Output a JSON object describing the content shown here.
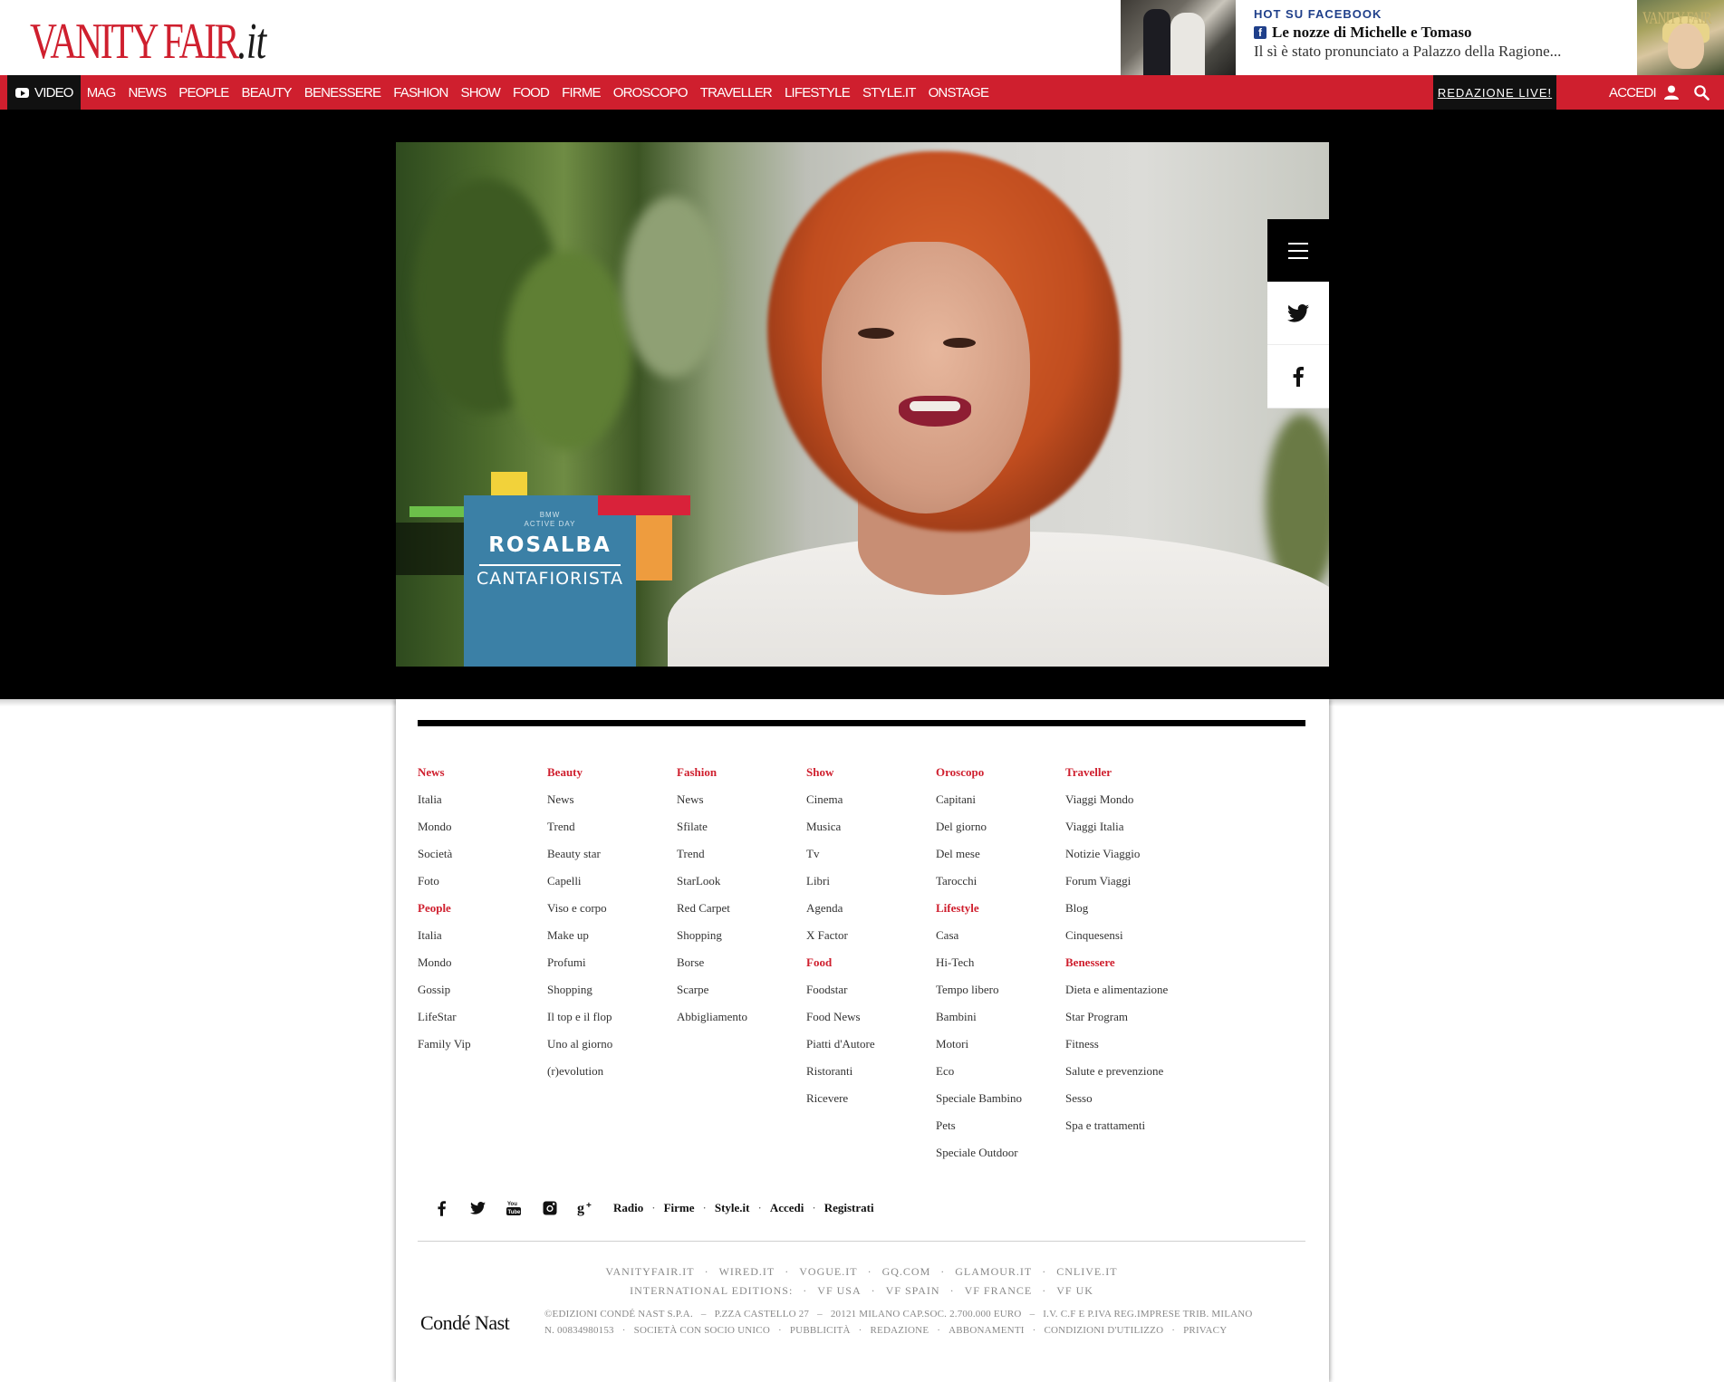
{
  "header": {
    "logo_main": "VANITY FAIR",
    "logo_suffix": ".it",
    "hot": {
      "label": "HOT SU FACEBOOK",
      "title": "Le nozze di Michelle e Tomaso",
      "subtitle": "Il sì è stato pronunciato a Palazzo della Ragione..."
    },
    "magazine_logo": "VANITY FAIR"
  },
  "nav": {
    "video_label": "VIDEO",
    "items": [
      "MAG",
      "NEWS",
      "PEOPLE",
      "BEAUTY",
      "BENESSERE",
      "FASHION",
      "SHOW",
      "FOOD",
      "FIRME",
      "OROSCOPO",
      "TRAVELLER",
      "LIFESTYLE",
      "STYLE.IT",
      "ONSTAGE"
    ],
    "redazione": "REDAZIONE LIVE!",
    "accedi": "ACCEDI"
  },
  "video": {
    "lower_third_small_1": "BMW",
    "lower_third_small_2": "ACTIVE DAY",
    "name": "ROSALBA",
    "surname": "CANTAFIORISTA"
  },
  "share": {
    "menu_icon": "hamburger-icon",
    "buttons": [
      "twitter-icon",
      "facebook-icon"
    ]
  },
  "footer": {
    "columns": [
      [
        {
          "text": "News",
          "head": true
        },
        {
          "text": "Italia"
        },
        {
          "text": "Mondo"
        },
        {
          "text": "Società"
        },
        {
          "text": "Foto"
        },
        {
          "text": "People",
          "head": true
        },
        {
          "text": "Italia"
        },
        {
          "text": "Mondo"
        },
        {
          "text": "Gossip"
        },
        {
          "text": "LifeStar"
        },
        {
          "text": "Family Vip"
        }
      ],
      [
        {
          "text": "Beauty",
          "head": true
        },
        {
          "text": "News"
        },
        {
          "text": "Trend"
        },
        {
          "text": "Beauty star"
        },
        {
          "text": "Capelli"
        },
        {
          "text": "Viso e corpo"
        },
        {
          "text": "Make up"
        },
        {
          "text": "Profumi"
        },
        {
          "text": "Shopping"
        },
        {
          "text": "Il top e il flop"
        },
        {
          "text": "Uno al giorno"
        },
        {
          "text": "(r)evolution"
        }
      ],
      [
        {
          "text": "Fashion",
          "head": true
        },
        {
          "text": "News"
        },
        {
          "text": "Sfilate"
        },
        {
          "text": "Trend"
        },
        {
          "text": "StarLook"
        },
        {
          "text": "Red Carpet"
        },
        {
          "text": "Shopping"
        },
        {
          "text": "Borse"
        },
        {
          "text": "Scarpe"
        },
        {
          "text": "Abbigliamento"
        }
      ],
      [
        {
          "text": "Show",
          "head": true
        },
        {
          "text": "Cinema"
        },
        {
          "text": "Musica"
        },
        {
          "text": "Tv"
        },
        {
          "text": "Libri"
        },
        {
          "text": "Agenda"
        },
        {
          "text": "X Factor"
        },
        {
          "text": "Food",
          "head": true
        },
        {
          "text": "Foodstar"
        },
        {
          "text": "Food News"
        },
        {
          "text": "Piatti d'Autore"
        },
        {
          "text": "Ristoranti"
        },
        {
          "text": "Ricevere"
        }
      ],
      [
        {
          "text": "Oroscopo",
          "head": true
        },
        {
          "text": "Capitani"
        },
        {
          "text": "Del giorno"
        },
        {
          "text": "Del mese"
        },
        {
          "text": "Tarocchi"
        },
        {
          "text": "Lifestyle",
          "head": true
        },
        {
          "text": "Casa"
        },
        {
          "text": "Hi-Tech"
        },
        {
          "text": "Tempo libero"
        },
        {
          "text": "Bambini"
        },
        {
          "text": "Motori"
        },
        {
          "text": "Eco"
        },
        {
          "text": "Speciale Bambino"
        },
        {
          "text": "Pets"
        },
        {
          "text": "Speciale Outdoor"
        }
      ],
      [
        {
          "text": "Traveller",
          "head": true
        },
        {
          "text": "Viaggi Mondo"
        },
        {
          "text": "Viaggi Italia"
        },
        {
          "text": "Notizie Viaggio"
        },
        {
          "text": "Forum Viaggi"
        },
        {
          "text": "Blog"
        },
        {
          "text": "Cinquesensi"
        },
        {
          "text": "Benessere",
          "head": true
        },
        {
          "text": "Dieta e alimentazione"
        },
        {
          "text": "Star Program"
        },
        {
          "text": "Fitness"
        },
        {
          "text": "Salute e prevenzione"
        },
        {
          "text": "Sesso"
        },
        {
          "text": "Spa e trattamenti"
        }
      ]
    ],
    "social_icons": [
      "facebook-icon",
      "twitter-icon",
      "youtube-icon",
      "instagram-icon",
      "googleplus-icon"
    ],
    "links": [
      "Radio",
      "Firme",
      "Style.it",
      "Accedi",
      "Registrati"
    ],
    "network_row1": [
      "VANITYFAIR.IT",
      "WIRED.IT",
      "VOGUE.IT",
      "GQ.COM",
      "GLAMOUR.IT",
      "CNLIVE.IT"
    ],
    "network_row2": [
      "INTERNATIONAL EDITIONS:",
      "VF USA",
      "VF SPAIN",
      "VF FRANCE",
      "VF UK"
    ],
    "conde_nast": "Condé Nast",
    "legal_line1": [
      "©EDIZIONI CONDÉ NAST S.P.A.",
      "P.ZZA CASTELLO 27",
      "20121 MILANO CAP.SOC. 2.700.000 EURO",
      "I.V. C.F E P.IVA REG.IMPRESE TRIB. MILANO"
    ],
    "legal_line2": [
      "N. 00834980153",
      "SOCIETÀ CON SOCIO UNICO",
      "PUBBLICITÀ",
      "REDAZIONE",
      "ABBONAMENTI",
      "CONDIZIONI D'UTILIZZO",
      "PRIVACY"
    ]
  }
}
